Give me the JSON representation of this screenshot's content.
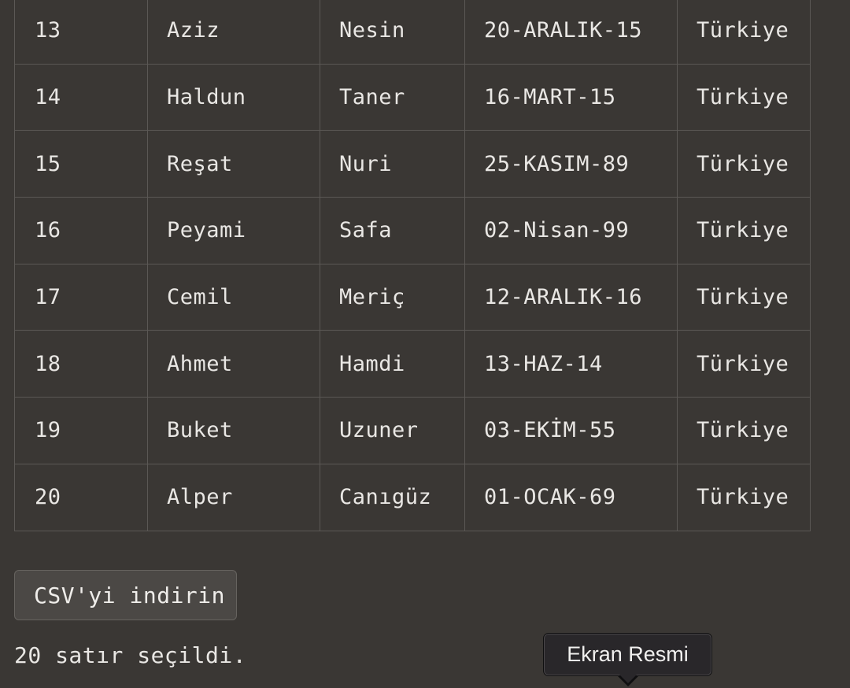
{
  "table": {
    "rows": [
      {
        "id": "13",
        "name": "Aziz",
        "surname": "Nesin",
        "date": "20-ARALIK-15",
        "country": "Türkiye"
      },
      {
        "id": "14",
        "name": "Haldun",
        "surname": "Taner",
        "date": "16-MART-15",
        "country": "Türkiye"
      },
      {
        "id": "15",
        "name": "Reşat",
        "surname": "Nuri",
        "date": "25-KASIM-89",
        "country": "Türkiye"
      },
      {
        "id": "16",
        "name": "Peyami",
        "surname": "Safa",
        "date": "02-Nisan-99",
        "country": "Türkiye"
      },
      {
        "id": "17",
        "name": "Cemil",
        "surname": "Meriç",
        "date": "12-ARALIK-16",
        "country": "Türkiye"
      },
      {
        "id": "18",
        "name": "Ahmet",
        "surname": "Hamdi",
        "date": "13-HAZ-14",
        "country": "Türkiye"
      },
      {
        "id": "19",
        "name": "Buket",
        "surname": "Uzuner",
        "date": "03-EKİM-55",
        "country": "Türkiye"
      },
      {
        "id": "20",
        "name": "Alper",
        "surname": "Canıgüz",
        "date": "01-OCAK-69",
        "country": "Türkiye"
      }
    ]
  },
  "download_button": {
    "label": "CSV'yi indirin"
  },
  "status": {
    "text": "20 satır seçildi."
  },
  "tooltip": {
    "text": "Ekran Resmi"
  },
  "colors": {
    "background": "#3a3734",
    "grid": "#5b5855",
    "button_bg": "#4b4845",
    "tooltip_bg": "#29272a"
  }
}
